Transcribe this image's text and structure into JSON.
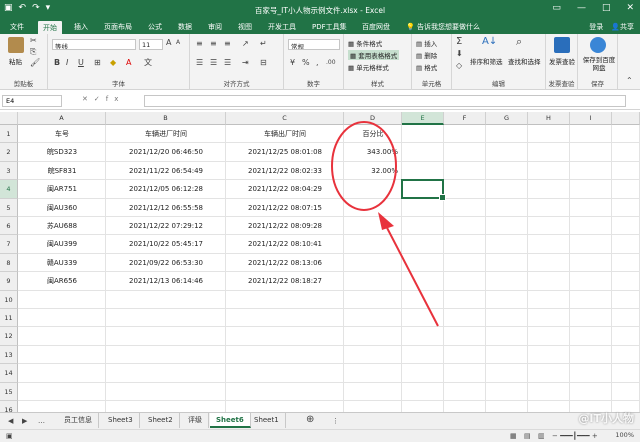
{
  "window": {
    "title": "百家号_IT小人物示例文件.xlsx - Excel"
  },
  "ribbon_tabs": [
    "文件",
    "开始",
    "插入",
    "页面布局",
    "公式",
    "数据",
    "审阅",
    "视图",
    "开发工具",
    "PDF工具集",
    "百度网盘"
  ],
  "tell_me": "告诉我您想要做什么",
  "account": {
    "login": "登录",
    "share": "共享"
  },
  "ribbon": {
    "clipboard": {
      "label": "剪贴板",
      "paste": "粘贴"
    },
    "font": {
      "label": "字体",
      "name": "等线",
      "size": "11"
    },
    "alignment": {
      "label": "对齐方式"
    },
    "number": {
      "label": "数字",
      "format": "常规"
    },
    "styles": {
      "label": "样式",
      "items": [
        "条件格式",
        "套用表格格式",
        "单元格样式"
      ]
    },
    "cells": {
      "label": "单元格",
      "items": [
        "插入",
        "删除",
        "格式"
      ]
    },
    "editing": {
      "label": "编辑",
      "sort": "排序和筛选",
      "find": "查找和选择"
    },
    "invoice": {
      "label": "发票查验",
      "button": "发票查验"
    },
    "save": {
      "label": "保存",
      "button": "保存到百度网盘"
    }
  },
  "formula_bar": {
    "name_box": "E4",
    "fx": "fx",
    "value": ""
  },
  "columns": [
    "A",
    "B",
    "C",
    "D",
    "E",
    "F",
    "G",
    "H",
    "I"
  ],
  "rows": [
    "1",
    "2",
    "3",
    "4",
    "5",
    "6",
    "7",
    "8",
    "9",
    "10",
    "11",
    "12",
    "13",
    "14",
    "15",
    "16"
  ],
  "table": {
    "headers": [
      "车号",
      "车辆进厂时间",
      "车辆出厂时间",
      "百分比"
    ],
    "rows": [
      [
        "皖SD323",
        "2021/12/20 06:46:50",
        "2021/12/25 08:01:08",
        "343.00%"
      ],
      [
        "皖SF831",
        "2021/11/22 06:54:49",
        "2021/12/22 08:02:33",
        "32.00%"
      ],
      [
        "闽AR751",
        "2021/12/05 06:12:28",
        "2021/12/22 08:04:29",
        ""
      ],
      [
        "闽AU360",
        "2021/12/12 06:55:58",
        "2021/12/22 08:07:15",
        ""
      ],
      [
        "苏AU688",
        "2021/12/22 07:29:12",
        "2021/12/22 08:09:28",
        ""
      ],
      [
        "闽AU399",
        "2021/10/22 05:45:17",
        "2021/12/22 08:10:41",
        ""
      ],
      [
        "赣AU339",
        "2021/09/22 06:53:30",
        "2021/12/22 08:13:06",
        ""
      ],
      [
        "闽AR656",
        "2021/12/13 06:14:46",
        "2021/12/22 08:18:27",
        ""
      ]
    ]
  },
  "sheet_tabs": [
    "员工信息",
    "Sheet3",
    "Sheet2",
    "评级",
    "Sheet6",
    "Sheet1"
  ],
  "active_sheet": "Sheet6",
  "zoom": "100%",
  "watermark": "@IT小人物",
  "colors": {
    "excel_green": "#217346",
    "annotation_red": "#e8323c"
  }
}
